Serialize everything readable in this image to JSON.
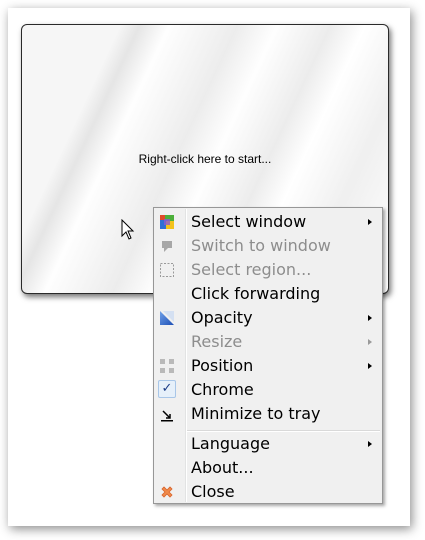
{
  "preview": {
    "hint_text": "Right-click here to start..."
  },
  "menu": {
    "items": [
      {
        "label": "Select window",
        "icon": "select-window-icon",
        "submenu": true,
        "disabled": false
      },
      {
        "label": "Switch to window",
        "icon": "switch-window-icon",
        "submenu": false,
        "disabled": true
      },
      {
        "label": "Select region...",
        "icon": "select-region-icon",
        "submenu": false,
        "disabled": true
      },
      {
        "label": "Click forwarding",
        "icon": "",
        "submenu": false,
        "disabled": false
      },
      {
        "label": "Opacity",
        "icon": "opacity-icon",
        "submenu": true,
        "disabled": false
      },
      {
        "label": "Resize",
        "icon": "",
        "submenu": true,
        "disabled": true
      },
      {
        "label": "Position",
        "icon": "position-icon",
        "submenu": true,
        "disabled": false
      },
      {
        "label": "Chrome",
        "icon": "checkmark-icon",
        "submenu": false,
        "disabled": false,
        "checked": true
      },
      {
        "label": "Minimize to tray",
        "icon": "minimize-to-tray-icon",
        "submenu": false,
        "disabled": false
      },
      {
        "label": "Language",
        "icon": "",
        "submenu": true,
        "disabled": false
      },
      {
        "label": "About...",
        "icon": "",
        "submenu": false,
        "disabled": false
      },
      {
        "label": "Close",
        "icon": "close-icon",
        "submenu": false,
        "disabled": false
      }
    ],
    "check_glyph": "✓"
  },
  "colors": {
    "menu_background": "#f0f0f0",
    "disabled_text": "#8d8d8d"
  }
}
